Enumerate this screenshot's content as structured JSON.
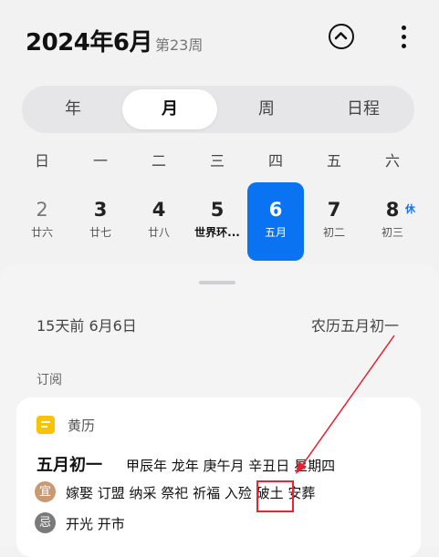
{
  "header": {
    "title": "2024年6月",
    "week": "第23周"
  },
  "view_tabs": [
    "年",
    "月",
    "周",
    "日程"
  ],
  "active_tab": "月",
  "weekdays": [
    "日",
    "一",
    "二",
    "三",
    "四",
    "五",
    "六"
  ],
  "dates": [
    {
      "day": "2",
      "lunar": "廿六"
    },
    {
      "day": "3",
      "lunar": "廿七"
    },
    {
      "day": "4",
      "lunar": "廿八"
    },
    {
      "day": "5",
      "lunar": "世界环..."
    },
    {
      "day": "6",
      "lunar": "五月"
    },
    {
      "day": "7",
      "lunar": "初二"
    },
    {
      "day": "8",
      "lunar": "初三"
    }
  ],
  "rest_badge": "休",
  "detail": {
    "days_ago": "15天前  6月6日",
    "lunar_date": "农历五月初一",
    "section_label": "订阅"
  },
  "almanac": {
    "title": "黄历",
    "date_main": "五月初一",
    "date_sub": "甲辰年 龙年 庚午月 辛丑日 星期四",
    "yi_label": "宜",
    "yi_items": "嫁娶 订盟 纳采 祭祀 祈福 入殓 破土 安葬",
    "ji_label": "忌",
    "ji_items": "开光 开市"
  },
  "colors": {
    "accent": "#0a73f2",
    "annotation": "#e22233"
  }
}
